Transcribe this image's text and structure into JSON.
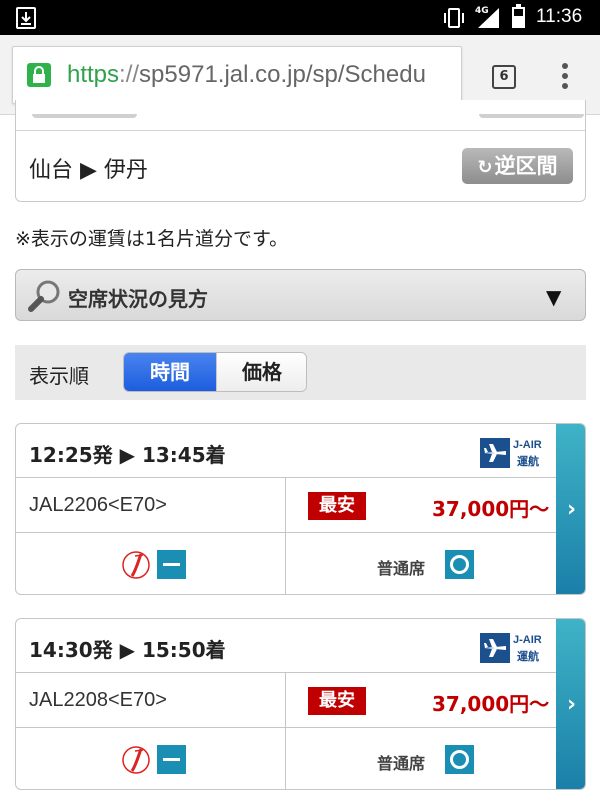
{
  "status_bar": {
    "time": "11:36",
    "network": "4G"
  },
  "browser": {
    "url_scheme": "https",
    "url_slashes": "://",
    "url_rest": "sp5971.jal.co.jp/sp/Schedu",
    "tab_count": "6"
  },
  "route": {
    "text": "仙台 ▶ 伊丹",
    "reverse_label": "逆区間"
  },
  "note": "※表示の運賃は1名片道分です。",
  "howto": {
    "label": "空席状況の見方"
  },
  "sort": {
    "label": "表示順",
    "options": [
      "時間",
      "価格"
    ],
    "selected": "時間"
  },
  "flights": [
    {
      "times": "12:25発 ▶ 13:45着",
      "operator_line1": "J-AIR",
      "operator_line2": "運航",
      "flight_no": "JAL2206<E70>",
      "fare_badge": "最安",
      "fare": "37,000円〜",
      "seat_class": "普通席"
    },
    {
      "times": "14:30発 ▶ 15:50着",
      "operator_line1": "J-AIR",
      "operator_line2": "運航",
      "flight_no": "JAL2208<E70>",
      "fare_badge": "最安",
      "fare": "37,000円〜",
      "seat_class": "普通席"
    }
  ],
  "colors": {
    "accent_blue": "#1d5ede",
    "fare_red": "#c00000",
    "status_teal": "#1a8fb3",
    "jair_navy": "#1b4f8e",
    "ssl_green": "#2fb24a"
  }
}
